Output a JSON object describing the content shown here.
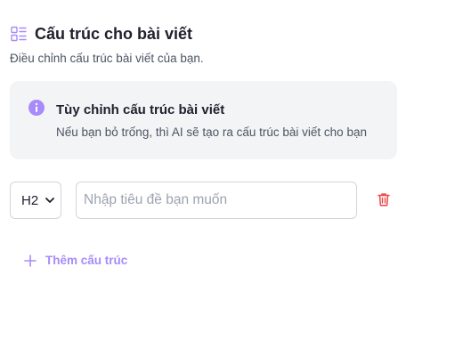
{
  "header": {
    "icon": "list-structure-icon",
    "title": "Cấu trúc cho bài viết",
    "subtitle": "Điều chỉnh cấu trúc bài viết của bạn."
  },
  "info_box": {
    "icon": "info-icon",
    "title": "Tùy chỉnh cấu trúc bài viết",
    "description": "Nếu bạn bỏ trống, thì AI sẽ tạo ra cấu trúc bài viết cho bạn"
  },
  "structure_rows": [
    {
      "heading_level": "H2",
      "title_value": "",
      "title_placeholder": "Nhập tiêu đề bạn muốn",
      "delete_icon": "trash-icon"
    }
  ],
  "add_button": {
    "icon": "plus-icon",
    "label": "Thêm cấu trúc"
  },
  "colors": {
    "accent": "#a78bfa",
    "danger": "#ef4444",
    "info_bg": "#f3f4f6",
    "text": "#1f1f2e",
    "muted": "#4b5563"
  }
}
